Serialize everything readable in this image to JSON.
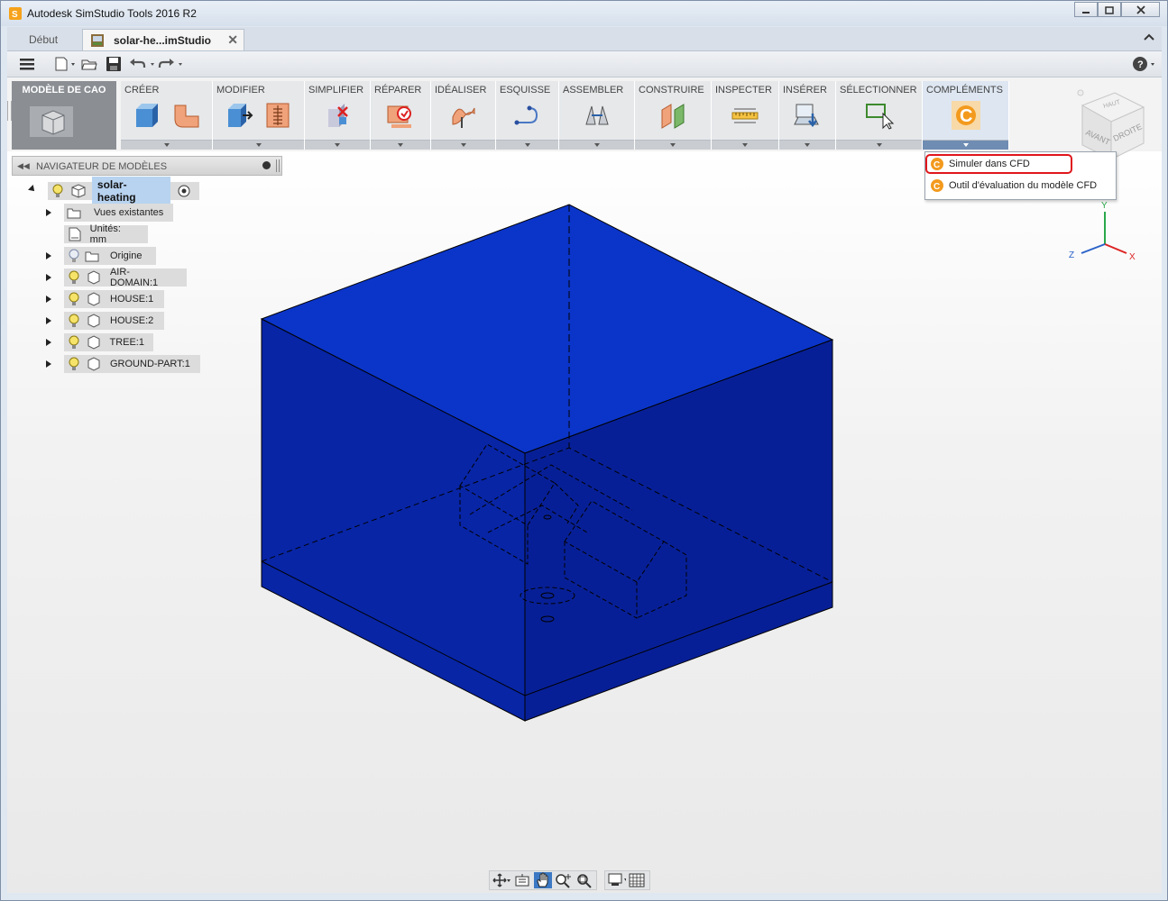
{
  "window": {
    "title": "Autodesk SimStudio Tools 2016 R2"
  },
  "tabs": [
    {
      "label": "Début"
    },
    {
      "label": "solar-he...imStudio"
    }
  ],
  "workspace": {
    "label": "MODÈLE DE CAO"
  },
  "ribbon": {
    "panels": [
      {
        "label": "CRÉER"
      },
      {
        "label": "MODIFIER"
      },
      {
        "label": "SIMPLIFIER"
      },
      {
        "label": "RÉPARER"
      },
      {
        "label": "IDÉALISER"
      },
      {
        "label": "ESQUISSE"
      },
      {
        "label": "ASSEMBLER"
      },
      {
        "label": "CONSTRUIRE"
      },
      {
        "label": "INSPECTER"
      },
      {
        "label": "INSÉRER"
      },
      {
        "label": "SÉLECTIONNER"
      },
      {
        "label": "COMPLÉMENTS"
      }
    ]
  },
  "dropdown": {
    "items": [
      {
        "label": "Simuler dans CFD"
      },
      {
        "label": "Outil d'évaluation du modèle CFD"
      }
    ]
  },
  "browser": {
    "title": "NAVIGATEUR DE MODÈLES",
    "root": "solar-heating",
    "items": [
      {
        "label": "Vues existantes"
      },
      {
        "label": "Unités: mm"
      },
      {
        "label": "Origine"
      },
      {
        "label": "AIR-DOMAIN:1"
      },
      {
        "label": "HOUSE:1"
      },
      {
        "label": "HOUSE:2"
      },
      {
        "label": "TREE:1"
      },
      {
        "label": "GROUND-PART:1"
      }
    ]
  },
  "viewcube": {
    "faces": [
      "HAUT",
      "AVANT",
      "DROITE"
    ]
  },
  "triad": {
    "x": "X",
    "y": "Y",
    "z": "Z"
  },
  "colors": {
    "model_fill": "#0a2fb8",
    "accent": "#3c79c4",
    "highlight_border": "#e0161c"
  }
}
